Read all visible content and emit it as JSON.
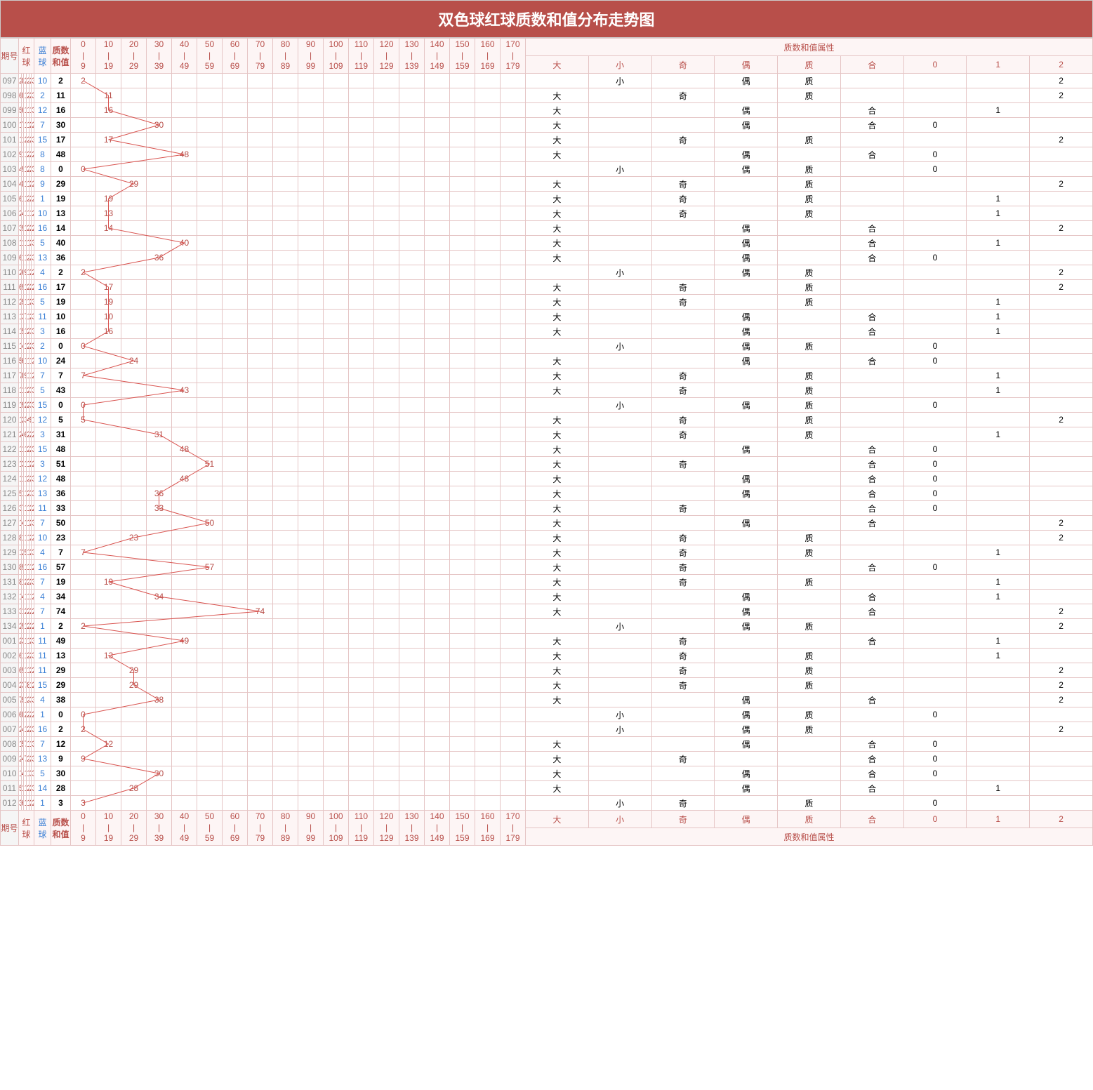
{
  "title": "双色球红球质数和值分布走势图",
  "headers": {
    "period": "期号",
    "red": "红球",
    "blue": "蓝球",
    "sum": "质数和值",
    "attr_group": "质数和值属性",
    "attrs": [
      "大",
      "小",
      "奇",
      "偶",
      "质",
      "合",
      "0",
      "1",
      "2"
    ]
  },
  "buckets": [
    {
      "lo": 0,
      "hi": 9
    },
    {
      "lo": 10,
      "hi": 19
    },
    {
      "lo": 20,
      "hi": 29
    },
    {
      "lo": 30,
      "hi": 39
    },
    {
      "lo": 40,
      "hi": 49
    },
    {
      "lo": 50,
      "hi": 59
    },
    {
      "lo": 60,
      "hi": 69
    },
    {
      "lo": 70,
      "hi": 79
    },
    {
      "lo": 80,
      "hi": 89
    },
    {
      "lo": 90,
      "hi": 99
    },
    {
      "lo": 100,
      "hi": 109
    },
    {
      "lo": 110,
      "hi": 119
    },
    {
      "lo": 120,
      "hi": 129
    },
    {
      "lo": 130,
      "hi": 139
    },
    {
      "lo": 140,
      "hi": 149
    },
    {
      "lo": 150,
      "hi": 159
    },
    {
      "lo": 160,
      "hi": 169
    },
    {
      "lo": 170,
      "hi": 179
    }
  ],
  "chart_data": {
    "type": "line",
    "title": "双色球红球质数和值分布走势图",
    "xlabel": "期号",
    "ylabel": "质数和值",
    "rows": [
      {
        "period": "097",
        "red": [
          2,
          8,
          21,
          25,
          26,
          30
        ],
        "blue": 10,
        "sum": 2,
        "attrs": [
          "",
          "小",
          "",
          "偶",
          "质",
          "",
          "",
          "",
          "2"
        ]
      },
      {
        "period": "098",
        "red": [
          6,
          8,
          11,
          22,
          25,
          33
        ],
        "blue": 2,
        "sum": 11,
        "attrs": [
          "大",
          "",
          "奇",
          "",
          "质",
          "",
          "",
          "",
          "2"
        ]
      },
      {
        "period": "099",
        "red": [
          5,
          6,
          11,
          12,
          15,
          30
        ],
        "blue": 12,
        "sum": 16,
        "attrs": [
          "大",
          "",
          "",
          "偶",
          "",
          "合",
          "",
          "1",
          ""
        ]
      },
      {
        "period": "100",
        "red": [
          1,
          7,
          15,
          16,
          20,
          23
        ],
        "blue": 7,
        "sum": 30,
        "attrs": [
          "大",
          "",
          "",
          "偶",
          "",
          "合",
          "0",
          "",
          ""
        ]
      },
      {
        "period": "101",
        "red": [
          10,
          17,
          24,
          25,
          28,
          30
        ],
        "blue": 15,
        "sum": 17,
        "attrs": [
          "大",
          "",
          "奇",
          "",
          "质",
          "",
          "",
          "",
          "2"
        ]
      },
      {
        "period": "102",
        "red": [
          9,
          10,
          19,
          25,
          26,
          29
        ],
        "blue": 8,
        "sum": 48,
        "attrs": [
          "大",
          "",
          "",
          "偶",
          "",
          "合",
          "0",
          "",
          ""
        ]
      },
      {
        "period": "103",
        "red": [
          4,
          9,
          10,
          22,
          28,
          32
        ],
        "blue": 8,
        "sum": 0,
        "attrs": [
          "",
          "小",
          "",
          "偶",
          "质",
          "",
          "0",
          "",
          ""
        ]
      },
      {
        "period": "104",
        "red": [
          4,
          8,
          10,
          16,
          27,
          29
        ],
        "blue": 9,
        "sum": 29,
        "attrs": [
          "大",
          "",
          "奇",
          "",
          "质",
          "",
          "",
          "",
          "2"
        ]
      },
      {
        "period": "105",
        "red": [
          6,
          14,
          19,
          20,
          22,
          24
        ],
        "blue": 1,
        "sum": 19,
        "attrs": [
          "大",
          "",
          "奇",
          "",
          "质",
          "",
          "",
          "1",
          ""
        ]
      },
      {
        "period": "106",
        "red": [
          2,
          4,
          11,
          15,
          18,
          28
        ],
        "blue": 10,
        "sum": 13,
        "attrs": [
          "大",
          "",
          "奇",
          "",
          "质",
          "",
          "",
          "1",
          ""
        ]
      },
      {
        "period": "107",
        "red": [
          3,
          9,
          11,
          24,
          25,
          28
        ],
        "blue": 16,
        "sum": 14,
        "attrs": [
          "大",
          "",
          "",
          "偶",
          "",
          "合",
          "",
          "",
          "2"
        ]
      },
      {
        "period": "108",
        "red": [
          10,
          12,
          15,
          17,
          23,
          32
        ],
        "blue": 5,
        "sum": 40,
        "attrs": [
          "大",
          "",
          "",
          "偶",
          "",
          "合",
          "",
          "1",
          ""
        ]
      },
      {
        "period": "109",
        "red": [
          6,
          13,
          16,
          20,
          23,
          32
        ],
        "blue": 13,
        "sum": 36,
        "attrs": [
          "大",
          "",
          "",
          "偶",
          "",
          "合",
          "0",
          "",
          ""
        ]
      },
      {
        "period": "110",
        "red": [
          2,
          6,
          9,
          14,
          22,
          25
        ],
        "blue": 4,
        "sum": 2,
        "attrs": [
          "",
          "小",
          "",
          "偶",
          "质",
          "",
          "",
          "",
          "2"
        ]
      },
      {
        "period": "111",
        "red": [
          6,
          9,
          17,
          22,
          24,
          26
        ],
        "blue": 16,
        "sum": 17,
        "attrs": [
          "大",
          "",
          "奇",
          "",
          "质",
          "",
          "",
          "",
          "2"
        ]
      },
      {
        "period": "112",
        "red": [
          2,
          9,
          12,
          17,
          28,
          32
        ],
        "blue": 5,
        "sum": 19,
        "attrs": [
          "大",
          "",
          "奇",
          "",
          "质",
          "",
          "",
          "1",
          ""
        ]
      },
      {
        "period": "113",
        "red": [
          1,
          3,
          7,
          10,
          22,
          32
        ],
        "blue": 11,
        "sum": 10,
        "attrs": [
          "大",
          "",
          "",
          "偶",
          "",
          "合",
          "",
          "1",
          ""
        ]
      },
      {
        "period": "114",
        "red": [
          1,
          5,
          11,
          24,
          30,
          32
        ],
        "blue": 3,
        "sum": 16,
        "attrs": [
          "大",
          "",
          "",
          "偶",
          "",
          "合",
          "",
          "1",
          ""
        ]
      },
      {
        "period": "115",
        "red": [
          1,
          4,
          12,
          20,
          25,
          32
        ],
        "blue": 2,
        "sum": 0,
        "attrs": [
          "",
          "小",
          "",
          "偶",
          "质",
          "",
          "0",
          "",
          ""
        ]
      },
      {
        "period": "116",
        "red": [
          5,
          6,
          14,
          16,
          19,
          27
        ],
        "blue": 10,
        "sum": 24,
        "attrs": [
          "大",
          "",
          "",
          "偶",
          "",
          "合",
          "0",
          "",
          ""
        ]
      },
      {
        "period": "117",
        "red": [
          7,
          8,
          9,
          10,
          16,
          27
        ],
        "blue": 7,
        "sum": 7,
        "attrs": [
          "大",
          "",
          "奇",
          "",
          "质",
          "",
          "",
          "1",
          ""
        ]
      },
      {
        "period": "118",
        "red": [
          11,
          13,
          19,
          26,
          30,
          33
        ],
        "blue": 5,
        "sum": 43,
        "attrs": [
          "大",
          "",
          "奇",
          "",
          "质",
          "",
          "",
          "1",
          ""
        ]
      },
      {
        "period": "119",
        "red": [
          1,
          9,
          22,
          28,
          32,
          33
        ],
        "blue": 15,
        "sum": 0,
        "attrs": [
          "",
          "小",
          "",
          "偶",
          "质",
          "",
          "0",
          "",
          ""
        ]
      },
      {
        "period": "120",
        "red": [
          1,
          2,
          3,
          4,
          9,
          10
        ],
        "blue": 12,
        "sum": 5,
        "attrs": [
          "大",
          "",
          "奇",
          "",
          "质",
          "",
          "",
          "",
          "2"
        ]
      },
      {
        "period": "121",
        "red": [
          2,
          4,
          6,
          21,
          25,
          29
        ],
        "blue": 3,
        "sum": 31,
        "attrs": [
          "大",
          "",
          "奇",
          "",
          "质",
          "",
          "",
          "1",
          ""
        ]
      },
      {
        "period": "122",
        "red": [
          12,
          15,
          17,
          24,
          26,
          31
        ],
        "blue": 15,
        "sum": 48,
        "attrs": [
          "大",
          "",
          "",
          "偶",
          "",
          "合",
          "0",
          "",
          ""
        ]
      },
      {
        "period": "123",
        "red": [
          1,
          3,
          18,
          19,
          26,
          29
        ],
        "blue": 3,
        "sum": 51,
        "attrs": [
          "大",
          "",
          "奇",
          "",
          "",
          "合",
          "0",
          "",
          ""
        ]
      },
      {
        "period": "124",
        "red": [
          16,
          18,
          19,
          20,
          29,
          33
        ],
        "blue": 12,
        "sum": 48,
        "attrs": [
          "大",
          "",
          "",
          "偶",
          "",
          "合",
          "0",
          "",
          ""
        ]
      },
      {
        "period": "125",
        "red": [
          5,
          12,
          16,
          26,
          30,
          31
        ],
        "blue": 13,
        "sum": 36,
        "attrs": [
          "大",
          "",
          "",
          "偶",
          "",
          "合",
          "0",
          "",
          ""
        ]
      },
      {
        "period": "126",
        "red": [
          3,
          7,
          12,
          14,
          23,
          28
        ],
        "blue": 11,
        "sum": 33,
        "attrs": [
          "大",
          "",
          "奇",
          "",
          "",
          "合",
          "0",
          "",
          ""
        ]
      },
      {
        "period": "127",
        "red": [
          1,
          4,
          18,
          19,
          26,
          31
        ],
        "blue": 7,
        "sum": 50,
        "attrs": [
          "大",
          "",
          "",
          "偶",
          "",
          "合",
          "",
          "",
          "2"
        ]
      },
      {
        "period": "128",
        "red": [
          8,
          10,
          15,
          16,
          23,
          26
        ],
        "blue": 10,
        "sum": 23,
        "attrs": [
          "大",
          "",
          "奇",
          "",
          "质",
          "",
          "",
          "",
          "2"
        ]
      },
      {
        "period": "129",
        "red": [
          1,
          2,
          5,
          15,
          28,
          33
        ],
        "blue": 4,
        "sum": 7,
        "attrs": [
          "大",
          "",
          "奇",
          "",
          "质",
          "",
          "",
          "1",
          ""
        ]
      },
      {
        "period": "130",
        "red": [
          8,
          9,
          11,
          14,
          17,
          29
        ],
        "blue": 16,
        "sum": 57,
        "attrs": [
          "大",
          "",
          "奇",
          "",
          "",
          "合",
          "0",
          "",
          ""
        ]
      },
      {
        "period": "131",
        "red": [
          8,
          19,
          22,
          26,
          27,
          30
        ],
        "blue": 7,
        "sum": 19,
        "attrs": [
          "大",
          "",
          "奇",
          "",
          "质",
          "",
          "",
          "1",
          ""
        ]
      },
      {
        "period": "132",
        "red": [
          1,
          4,
          11,
          12,
          14,
          23
        ],
        "blue": 4,
        "sum": 34,
        "attrs": [
          "大",
          "",
          "",
          "偶",
          "",
          "合",
          "",
          "1",
          ""
        ]
      },
      {
        "period": "133",
        "red": [
          3,
          19,
          22,
          23,
          27,
          29
        ],
        "blue": 7,
        "sum": 74,
        "attrs": [
          "大",
          "",
          "",
          "偶",
          "",
          "合",
          "",
          "",
          "2"
        ]
      },
      {
        "period": "134",
        "red": [
          2,
          9,
          10,
          20,
          22,
          26
        ],
        "blue": 1,
        "sum": 2,
        "attrs": [
          "",
          "小",
          "",
          "偶",
          "质",
          "",
          "",
          "",
          "2"
        ]
      },
      {
        "period": "001",
        "red": [
          2,
          3,
          13,
          18,
          20,
          31
        ],
        "blue": 11,
        "sum": 49,
        "attrs": [
          "大",
          "",
          "奇",
          "",
          "",
          "合",
          "",
          "1",
          ""
        ]
      },
      {
        "period": "002",
        "red": [
          6,
          10,
          13,
          25,
          26,
          32
        ],
        "blue": 11,
        "sum": 13,
        "attrs": [
          "大",
          "",
          "奇",
          "",
          "质",
          "",
          "",
          "1",
          ""
        ]
      },
      {
        "period": "003",
        "red": [
          6,
          9,
          16,
          18,
          22,
          29
        ],
        "blue": 11,
        "sum": 29,
        "attrs": [
          "大",
          "",
          "奇",
          "",
          "质",
          "",
          "",
          "",
          "2"
        ]
      },
      {
        "period": "004",
        "red": [
          2,
          3,
          7,
          8,
          17,
          22
        ],
        "blue": 15,
        "sum": 29,
        "attrs": [
          "大",
          "",
          "奇",
          "",
          "质",
          "",
          "",
          "",
          "2"
        ]
      },
      {
        "period": "005",
        "red": [
          7,
          9,
          14,
          26,
          30,
          31
        ],
        "blue": 4,
        "sum": 38,
        "attrs": [
          "大",
          "",
          "",
          "偶",
          "",
          "合",
          "",
          "",
          "2"
        ]
      },
      {
        "period": "006",
        "red": [
          6,
          8,
          22,
          24,
          25,
          26
        ],
        "blue": 1,
        "sum": 0,
        "attrs": [
          "",
          "小",
          "",
          "偶",
          "质",
          "",
          "0",
          "",
          ""
        ]
      },
      {
        "period": "007",
        "red": [
          2,
          4,
          12,
          21,
          25,
          32
        ],
        "blue": 16,
        "sum": 2,
        "attrs": [
          "",
          "小",
          "",
          "偶",
          "质",
          "",
          "",
          "",
          "2"
        ]
      },
      {
        "period": "008",
        "red": [
          1,
          5,
          7,
          14,
          18,
          33
        ],
        "blue": 7,
        "sum": 12,
        "attrs": [
          "大",
          "",
          "",
          "偶",
          "",
          "合",
          "0",
          "",
          ""
        ]
      },
      {
        "period": "009",
        "red": [
          2,
          4,
          7,
          24,
          25,
          32
        ],
        "blue": 13,
        "sum": 9,
        "attrs": [
          "大",
          "",
          "奇",
          "",
          "",
          "合",
          "0",
          "",
          ""
        ]
      },
      {
        "period": "010",
        "red": [
          1,
          4,
          11,
          19,
          32,
          33
        ],
        "blue": 5,
        "sum": 30,
        "attrs": [
          "大",
          "",
          "",
          "偶",
          "",
          "合",
          "0",
          "",
          ""
        ]
      },
      {
        "period": "011",
        "red": [
          5,
          10,
          16,
          23,
          27,
          33
        ],
        "blue": 14,
        "sum": 28,
        "attrs": [
          "大",
          "",
          "",
          "偶",
          "",
          "合",
          "",
          "1",
          ""
        ]
      },
      {
        "period": "012",
        "red": [
          3,
          6,
          14,
          18,
          20,
          26
        ],
        "blue": 1,
        "sum": 3,
        "attrs": [
          "",
          "小",
          "奇",
          "",
          "质",
          "",
          "0",
          "",
          ""
        ]
      }
    ]
  }
}
